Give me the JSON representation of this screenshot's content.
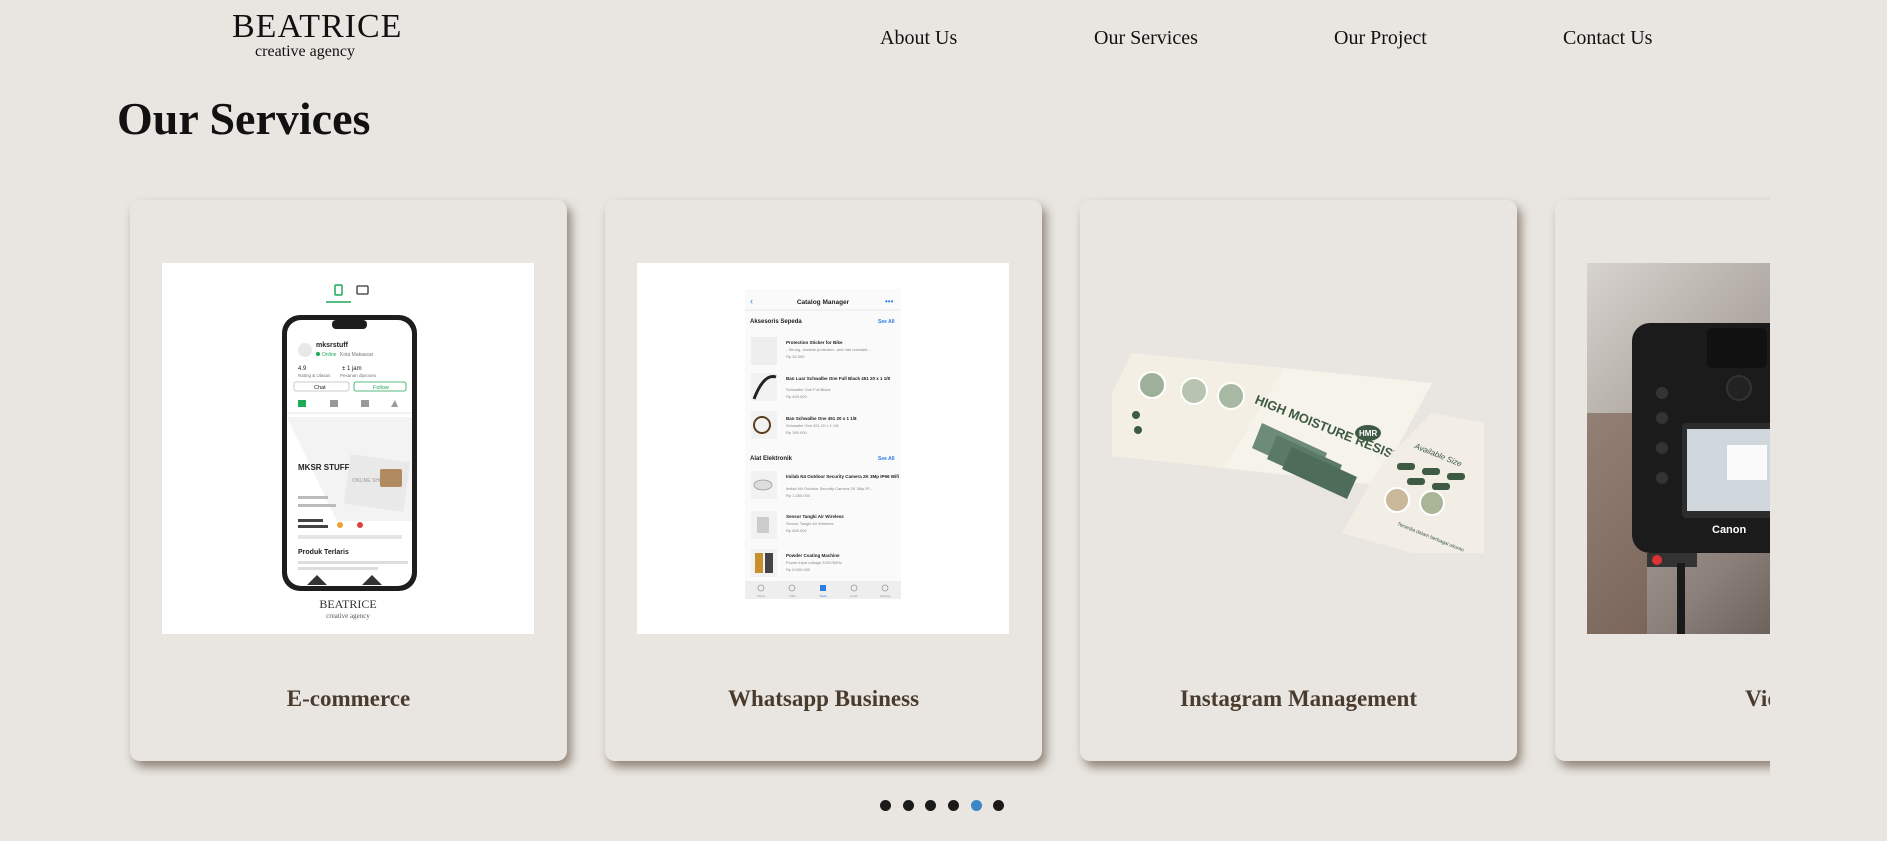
{
  "brand": {
    "name": "BEATRICE",
    "tagline": "creative agency"
  },
  "nav": {
    "about": "About Us",
    "services": "Our Services",
    "project": "Our Project",
    "contact": "Contact Us"
  },
  "page": {
    "title": "Our Services"
  },
  "cards": [
    {
      "label": "E-commerce",
      "image": "phone-store-mockup"
    },
    {
      "label": "Whatsapp Business",
      "image": "catalog-manager-mockup"
    },
    {
      "label": "Instagram Management",
      "image": "instagram-feed-mockup"
    },
    {
      "label": "Video",
      "image": "camera-photo"
    }
  ],
  "phone": {
    "store_name": "mksrstuff",
    "status": "Online",
    "location": "Kota Makassar",
    "rating": "4.9",
    "rating_label": "Rating & Ulasan",
    "time": "± 1 jam",
    "time_label": "Pesanan diproses",
    "chat": "Chat",
    "follow": "Follow",
    "banner_title": "MKSR STUFF",
    "banner_text": "ONLINE SHOPPING",
    "products_title": "Produk Terlaris",
    "footer_brand": "BEATRICE",
    "footer_tagline": "creative agency"
  },
  "catalog": {
    "title": "Catalog Manager",
    "sections": [
      {
        "name": "Aksesoris Sepeda",
        "see_all": "See All",
        "items": [
          {
            "name": "Protection Sticker for Bike",
            "desc": "- Strong, durable protection, and ride resistant...",
            "price": "Rp 30.000"
          },
          {
            "name": "Ban Luar Schwalbe One Full Black 451 20 x 1 1/8",
            "desc": "Schwalbe One Full Black",
            "price": "Rp 400.000"
          },
          {
            "name": "Ban Schwalbe One 451 20 x 1 1/8",
            "desc": "Schwalbe One 451 20 x 1 1/8",
            "price": "Rp 390.000"
          }
        ]
      },
      {
        "name": "Alat Elektronik",
        "see_all": "See All",
        "items": [
          {
            "name": "Imilab N4 Outdoor Security Camera 2K 3Mp IP66 Wifi",
            "desc": "Imilab N4 Outdoor Security Camera 2K 3Mp IP...",
            "price": "Rp 1.350.000"
          },
          {
            "name": "Sensor Tangki Air Wireless",
            "desc": "Sensor Tangki Air Wireless",
            "price": "Rp 800.000"
          },
          {
            "name": "Powder Coating Machine",
            "desc": "Power input voltage 220V/50Hz",
            "price": "Rp 8.000.000"
          }
        ]
      }
    ],
    "tabs": [
      "Status",
      "Calls",
      "Tools",
      "Chats",
      "Settings"
    ]
  },
  "instagram": {
    "headline": "HIGH MOISTURE RESISTANT",
    "badge": "HMR",
    "size_label": "Available Size",
    "note": "Tersedia dalam berbagai ukuran"
  },
  "camera": {
    "brand": "Canon"
  },
  "carousel": {
    "slide_count": 6,
    "active_index": 4
  },
  "colors": {
    "background": "#e9e6e1",
    "card_label": "#4a3b2f",
    "dot": "#1a1a1a",
    "dot_active": "#3b86c6",
    "whatsapp_green": "#1fa855"
  }
}
